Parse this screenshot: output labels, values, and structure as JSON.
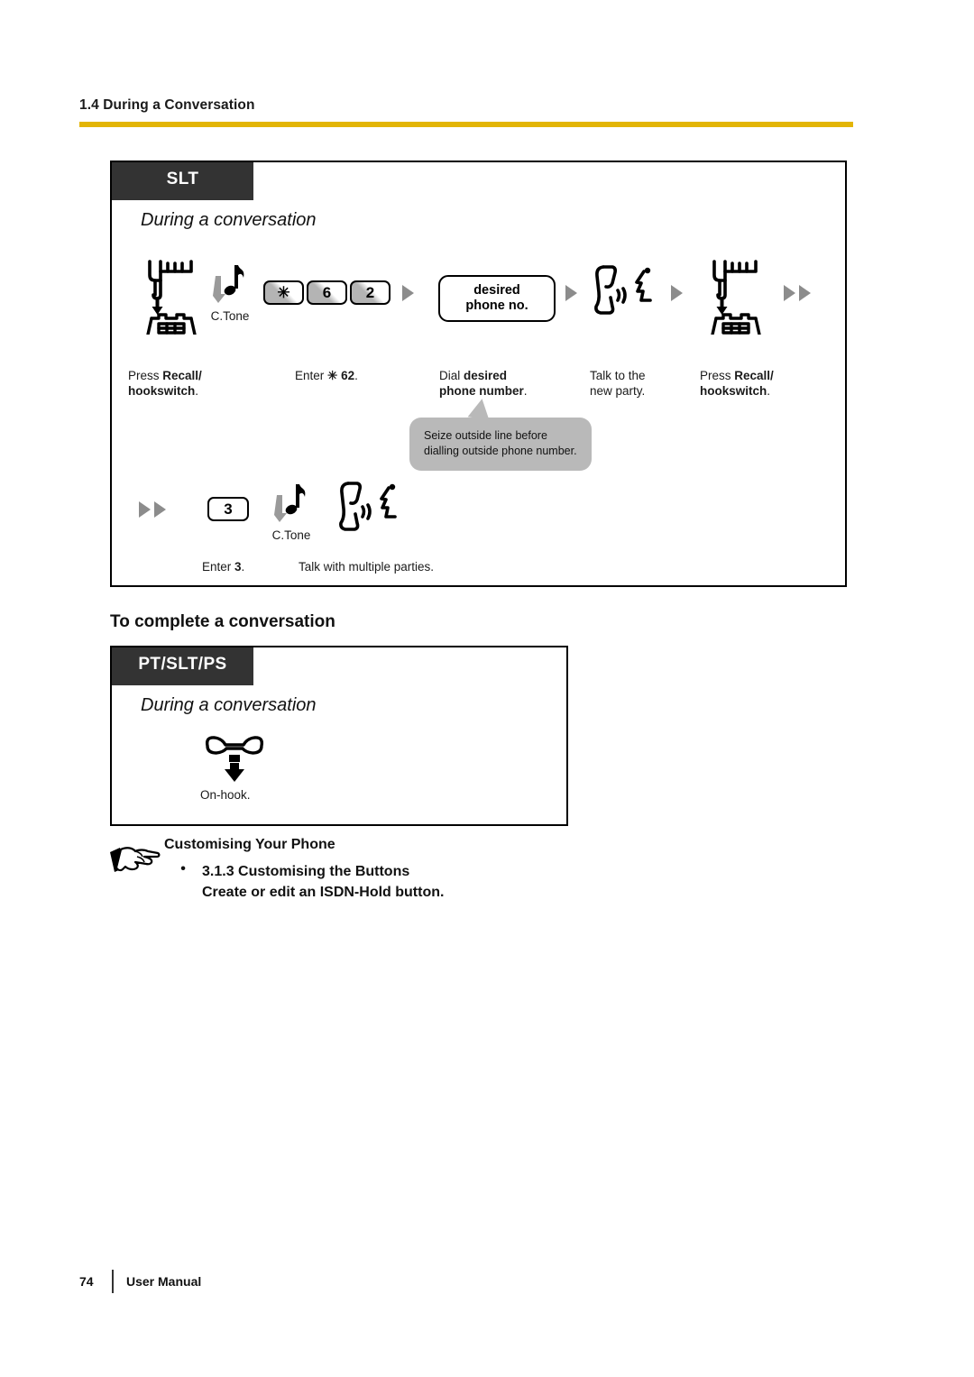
{
  "header": {
    "section_title": "1.4 During a Conversation",
    "rule_color": "#e3b505"
  },
  "slt_box": {
    "tag": "SLT",
    "subtitle": "During a conversation",
    "row1": {
      "step1": {
        "icon": "press-hookswitch-icon",
        "caption_plain1": "Press ",
        "caption_bold1": "Recall/",
        "caption_bold2": "hookswitch",
        "caption_plain2": "."
      },
      "ctone_label": "C.Tone",
      "keys": [
        "✳",
        "6",
        "2"
      ],
      "step2_caption_plain1": "Enter ",
      "step2_caption_bold": "✳ 62",
      "step2_caption_plain2": ".",
      "pill_line1": "desired",
      "pill_line2": "phone no.",
      "step3_caption_plain1": "Dial ",
      "step3_caption_bold1": "desired",
      "step3_caption_bold2": "phone number",
      "step3_caption_plain2": ".",
      "step4_caption_line1": "Talk to the",
      "step4_caption_line2": "new party.",
      "step5_caption_plain1": "Press ",
      "step5_caption_bold1": "Recall/",
      "step5_caption_bold2": "hookswitch",
      "step5_caption_plain2": "."
    },
    "callout": {
      "line1": "Seize outside line before",
      "line2": "dialling outside phone number.",
      "bg_color": "#b9b9b9"
    },
    "row2": {
      "key": "3",
      "ctone_label": "C.Tone",
      "caption1_plain": "Enter ",
      "caption1_bold": "3",
      "caption1_tail": ".",
      "caption2": "Talk with multiple parties."
    }
  },
  "complete_heading": "To complete a conversation",
  "ptsltps_box": {
    "tag": "PT/SLT/PS",
    "subtitle": "During a conversation",
    "icon": "on-hook-handset-icon",
    "caption": "On-hook."
  },
  "customising": {
    "pointer_icon": "pointing-hand-icon",
    "title": "Customising Your Phone",
    "bullet": "•",
    "line1": "3.1.3 Customising the Buttons",
    "line2": "Create or edit an ISDN-Hold button."
  },
  "footer": {
    "page_number": "74",
    "label": "User Manual"
  }
}
